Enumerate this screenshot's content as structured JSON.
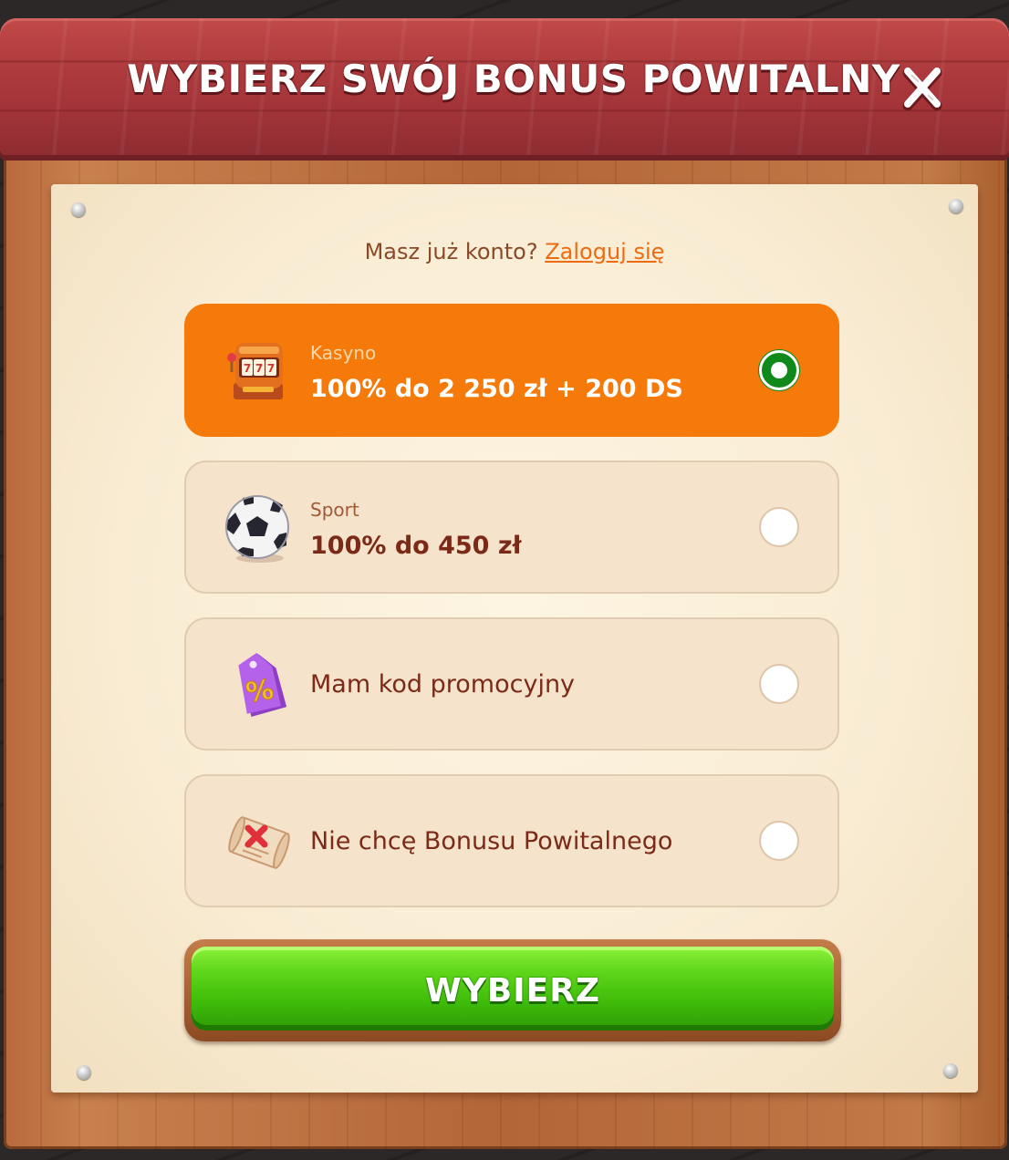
{
  "dialog": {
    "title": "WYBIERZ SWÓJ BONUS POWITALNY",
    "close_icon": "close-x-icon"
  },
  "login_prompt": {
    "text": "Masz już konto?",
    "link_label": "Zaloguj się"
  },
  "options": [
    {
      "id": "casino",
      "icon": "slot-machine-icon",
      "subtitle": "Kasyno",
      "title": "100% do 2 250 zł + 200 DS",
      "selected": true
    },
    {
      "id": "sport",
      "icon": "soccer-ball-icon",
      "subtitle": "Sport",
      "title": "100% do 450 zł",
      "selected": false
    },
    {
      "id": "promo-code",
      "icon": "percent-tag-icon",
      "title": "Mam kod promocyjny",
      "selected": false
    },
    {
      "id": "no-bonus",
      "icon": "scroll-cross-icon",
      "title": "Nie chcę Bonusu Powitalnego",
      "selected": false
    }
  ],
  "submit": {
    "label": "WYBIERZ"
  },
  "colors": {
    "header_red": "#b13d3f",
    "selected_orange": "#f57a0a",
    "radio_green": "#0f8a1a",
    "button_green": "#3fbd0a",
    "link_orange": "#ef6b12",
    "text_brown": "#7c2a18",
    "paper": "#f9ecd3"
  }
}
